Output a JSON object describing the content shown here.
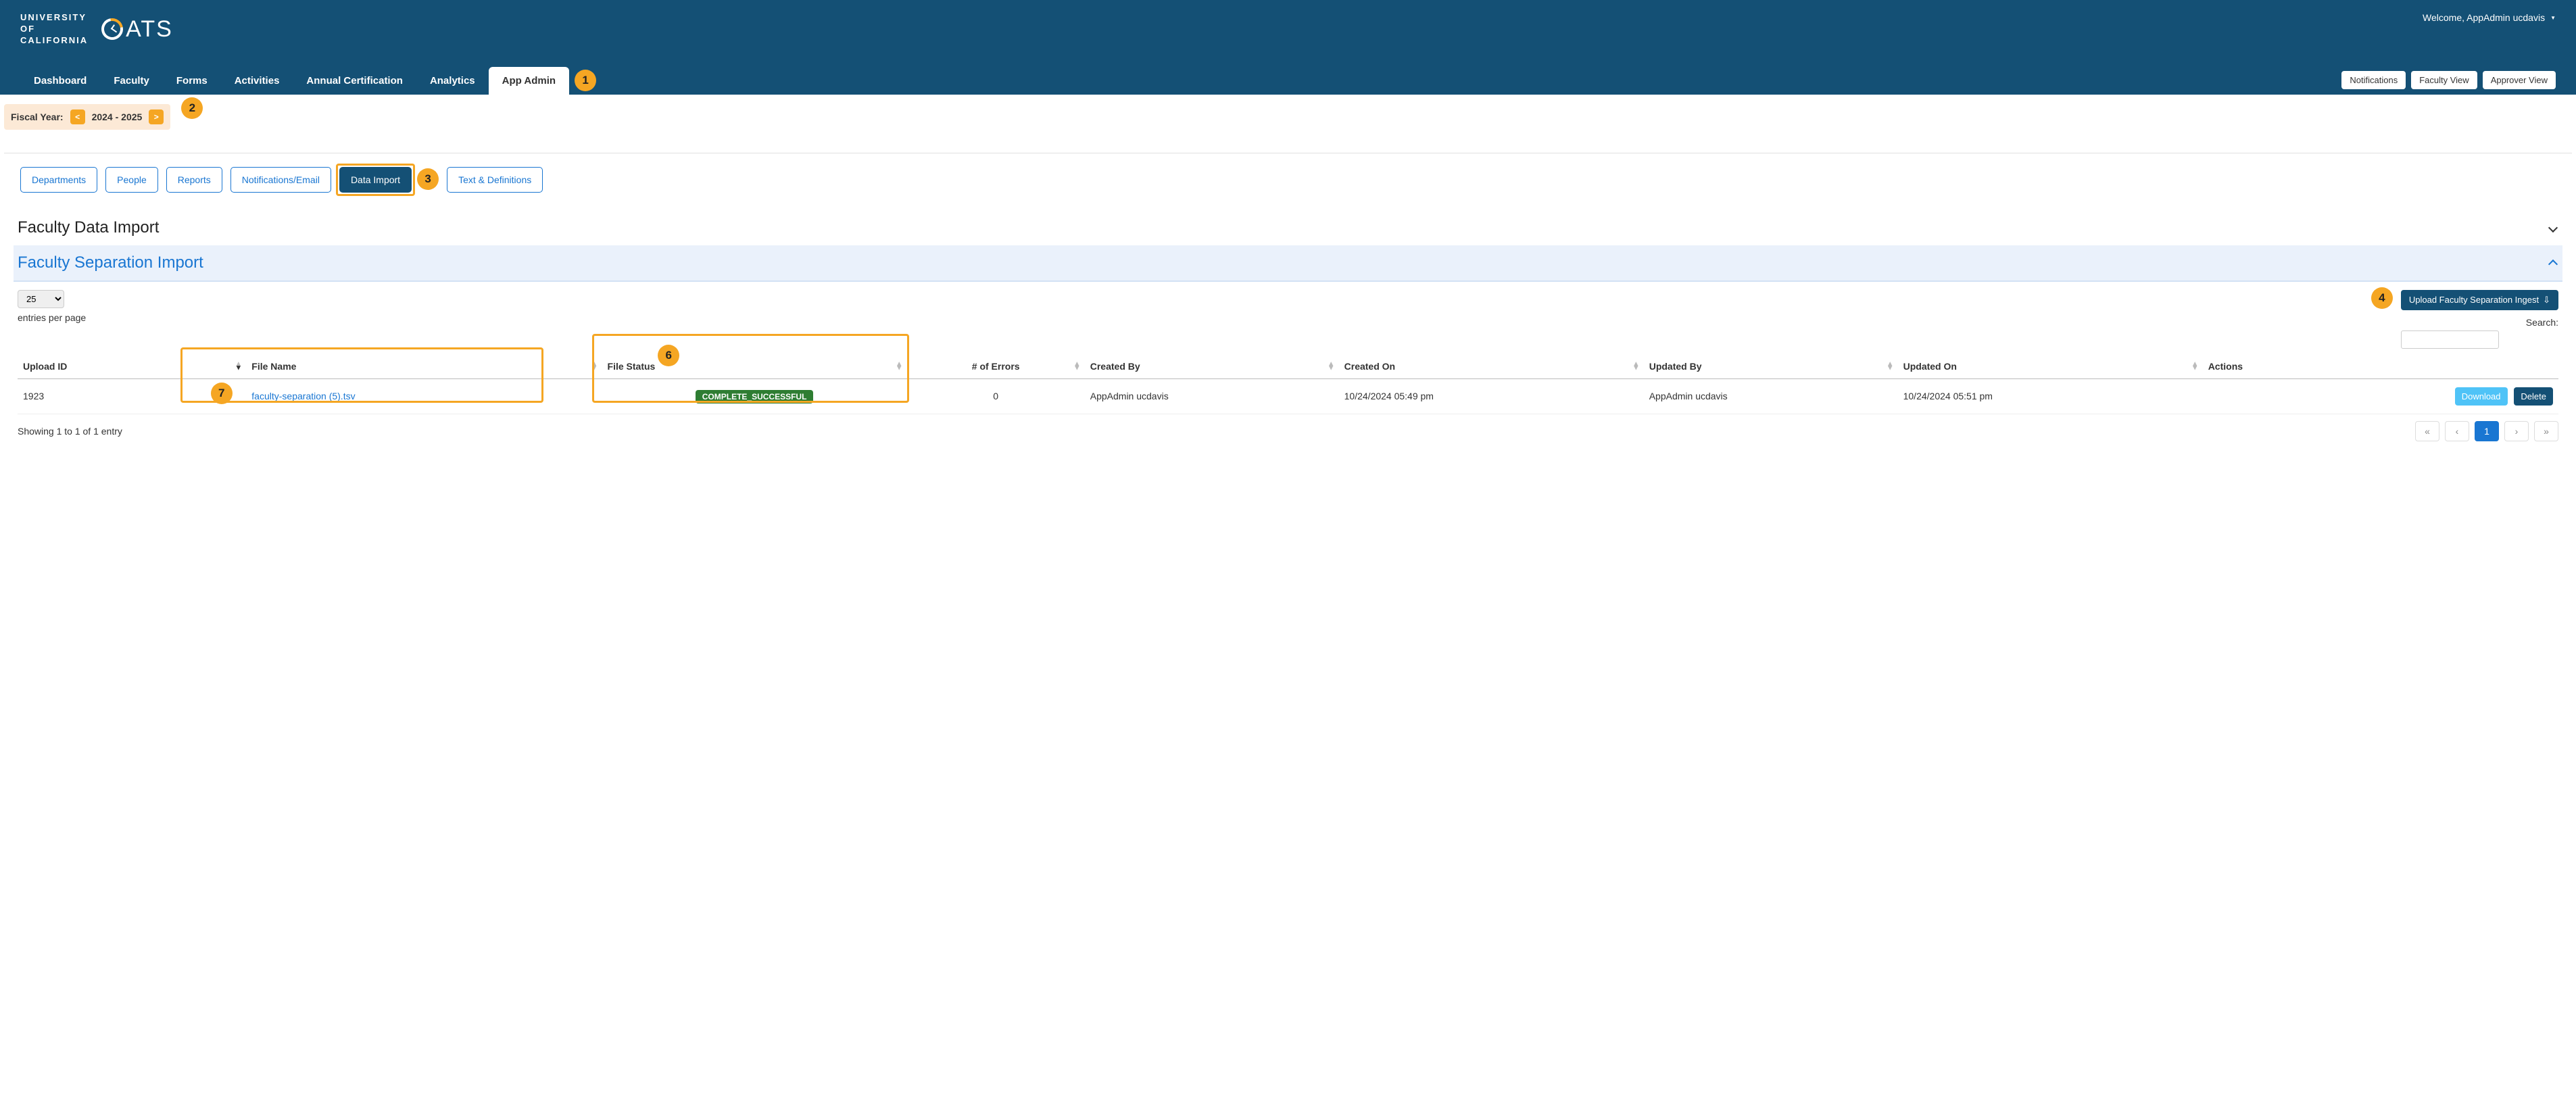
{
  "header": {
    "uc_logo_line1": "UNIVERSITY",
    "uc_logo_line2": "OF",
    "uc_logo_line3": "CALIFORNIA",
    "oats": "ATS",
    "welcome": "Welcome, AppAdmin ucdavis"
  },
  "nav_tabs": [
    "Dashboard",
    "Faculty",
    "Forms",
    "Activities",
    "Annual Certification",
    "Analytics",
    "App Admin"
  ],
  "nav_active_index": 6,
  "nav_actions": [
    "Notifications",
    "Faculty View",
    "Approver View"
  ],
  "fiscal": {
    "label": "Fiscal Year:",
    "year": "2024 - 2025"
  },
  "subtabs": [
    "Departments",
    "People",
    "Reports",
    "Notifications/Email",
    "Data Import",
    "Text & Definitions"
  ],
  "subtab_active_index": 4,
  "sections": {
    "collapsed_title": "Faculty Data Import",
    "expanded_title": "Faculty Separation Import"
  },
  "controls": {
    "page_size": "25",
    "entries_label": "entries per page",
    "upload_label": "Upload Faculty Separation Ingest",
    "search_label": "Search:"
  },
  "table": {
    "columns": [
      "Upload ID",
      "File Name",
      "File Status",
      "# of Errors",
      "Created By",
      "Created On",
      "Updated By",
      "Updated On",
      "Actions"
    ],
    "row": {
      "upload_id": "1923",
      "file_name": "faculty-separation (5).tsv",
      "file_status": "COMPLETE_SUCCESSFUL",
      "errors": "0",
      "created_by": "AppAdmin ucdavis",
      "created_on": "10/24/2024 05:49 pm",
      "updated_by": "AppAdmin ucdavis",
      "updated_on": "10/24/2024 05:51 pm",
      "download": "Download",
      "delete": "Delete"
    },
    "showing": "Showing 1 to 1 of 1 entry"
  },
  "pager": {
    "first": "«",
    "prev": "‹",
    "page": "1",
    "next": "›",
    "last": "»"
  },
  "callouts": [
    "1",
    "2",
    "3",
    "4",
    "6",
    "7"
  ]
}
